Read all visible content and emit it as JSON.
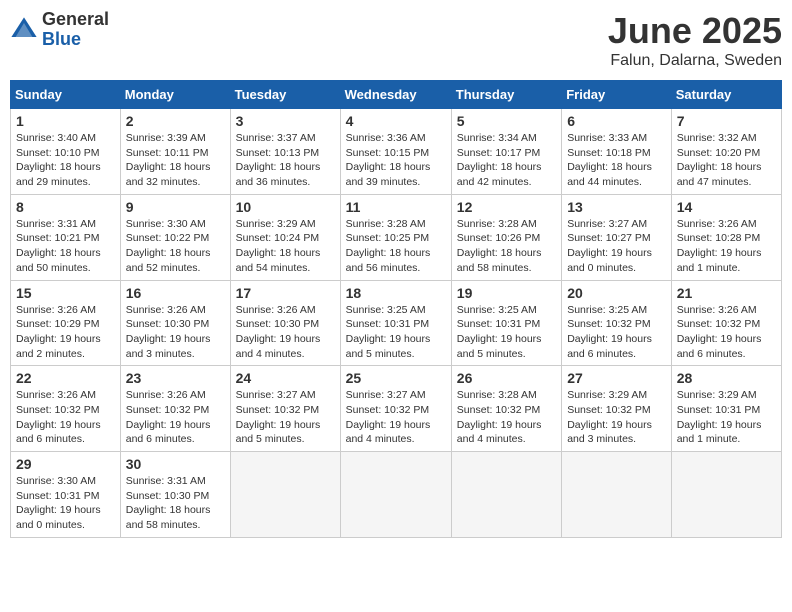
{
  "logo": {
    "general": "General",
    "blue": "Blue"
  },
  "title": "June 2025",
  "location": "Falun, Dalarna, Sweden",
  "days_of_week": [
    "Sunday",
    "Monday",
    "Tuesday",
    "Wednesday",
    "Thursday",
    "Friday",
    "Saturday"
  ],
  "weeks": [
    [
      {
        "day": "1",
        "info": "Sunrise: 3:40 AM\nSunset: 10:10 PM\nDaylight: 18 hours\nand 29 minutes."
      },
      {
        "day": "2",
        "info": "Sunrise: 3:39 AM\nSunset: 10:11 PM\nDaylight: 18 hours\nand 32 minutes."
      },
      {
        "day": "3",
        "info": "Sunrise: 3:37 AM\nSunset: 10:13 PM\nDaylight: 18 hours\nand 36 minutes."
      },
      {
        "day": "4",
        "info": "Sunrise: 3:36 AM\nSunset: 10:15 PM\nDaylight: 18 hours\nand 39 minutes."
      },
      {
        "day": "5",
        "info": "Sunrise: 3:34 AM\nSunset: 10:17 PM\nDaylight: 18 hours\nand 42 minutes."
      },
      {
        "day": "6",
        "info": "Sunrise: 3:33 AM\nSunset: 10:18 PM\nDaylight: 18 hours\nand 44 minutes."
      },
      {
        "day": "7",
        "info": "Sunrise: 3:32 AM\nSunset: 10:20 PM\nDaylight: 18 hours\nand 47 minutes."
      }
    ],
    [
      {
        "day": "8",
        "info": "Sunrise: 3:31 AM\nSunset: 10:21 PM\nDaylight: 18 hours\nand 50 minutes."
      },
      {
        "day": "9",
        "info": "Sunrise: 3:30 AM\nSunset: 10:22 PM\nDaylight: 18 hours\nand 52 minutes."
      },
      {
        "day": "10",
        "info": "Sunrise: 3:29 AM\nSunset: 10:24 PM\nDaylight: 18 hours\nand 54 minutes."
      },
      {
        "day": "11",
        "info": "Sunrise: 3:28 AM\nSunset: 10:25 PM\nDaylight: 18 hours\nand 56 minutes."
      },
      {
        "day": "12",
        "info": "Sunrise: 3:28 AM\nSunset: 10:26 PM\nDaylight: 18 hours\nand 58 minutes."
      },
      {
        "day": "13",
        "info": "Sunrise: 3:27 AM\nSunset: 10:27 PM\nDaylight: 19 hours\nand 0 minutes."
      },
      {
        "day": "14",
        "info": "Sunrise: 3:26 AM\nSunset: 10:28 PM\nDaylight: 19 hours\nand 1 minute."
      }
    ],
    [
      {
        "day": "15",
        "info": "Sunrise: 3:26 AM\nSunset: 10:29 PM\nDaylight: 19 hours\nand 2 minutes."
      },
      {
        "day": "16",
        "info": "Sunrise: 3:26 AM\nSunset: 10:30 PM\nDaylight: 19 hours\nand 3 minutes."
      },
      {
        "day": "17",
        "info": "Sunrise: 3:26 AM\nSunset: 10:30 PM\nDaylight: 19 hours\nand 4 minutes."
      },
      {
        "day": "18",
        "info": "Sunrise: 3:25 AM\nSunset: 10:31 PM\nDaylight: 19 hours\nand 5 minutes."
      },
      {
        "day": "19",
        "info": "Sunrise: 3:25 AM\nSunset: 10:31 PM\nDaylight: 19 hours\nand 5 minutes."
      },
      {
        "day": "20",
        "info": "Sunrise: 3:25 AM\nSunset: 10:32 PM\nDaylight: 19 hours\nand 6 minutes."
      },
      {
        "day": "21",
        "info": "Sunrise: 3:26 AM\nSunset: 10:32 PM\nDaylight: 19 hours\nand 6 minutes."
      }
    ],
    [
      {
        "day": "22",
        "info": "Sunrise: 3:26 AM\nSunset: 10:32 PM\nDaylight: 19 hours\nand 6 minutes."
      },
      {
        "day": "23",
        "info": "Sunrise: 3:26 AM\nSunset: 10:32 PM\nDaylight: 19 hours\nand 6 minutes."
      },
      {
        "day": "24",
        "info": "Sunrise: 3:27 AM\nSunset: 10:32 PM\nDaylight: 19 hours\nand 5 minutes."
      },
      {
        "day": "25",
        "info": "Sunrise: 3:27 AM\nSunset: 10:32 PM\nDaylight: 19 hours\nand 4 minutes."
      },
      {
        "day": "26",
        "info": "Sunrise: 3:28 AM\nSunset: 10:32 PM\nDaylight: 19 hours\nand 4 minutes."
      },
      {
        "day": "27",
        "info": "Sunrise: 3:29 AM\nSunset: 10:32 PM\nDaylight: 19 hours\nand 3 minutes."
      },
      {
        "day": "28",
        "info": "Sunrise: 3:29 AM\nSunset: 10:31 PM\nDaylight: 19 hours\nand 1 minute."
      }
    ],
    [
      {
        "day": "29",
        "info": "Sunrise: 3:30 AM\nSunset: 10:31 PM\nDaylight: 19 hours\nand 0 minutes."
      },
      {
        "day": "30",
        "info": "Sunrise: 3:31 AM\nSunset: 10:30 PM\nDaylight: 18 hours\nand 58 minutes."
      },
      null,
      null,
      null,
      null,
      null
    ]
  ]
}
